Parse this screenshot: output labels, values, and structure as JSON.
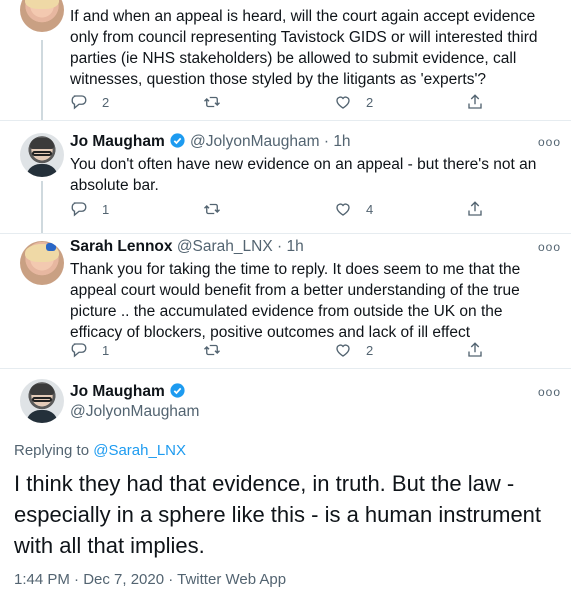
{
  "tweets": [
    {
      "text": "If and when an appeal is heard, will the court again accept evidence only from council representing Tavistock GIDS or will interested third parties (ie NHS stakeholders) be allowed to submit evidence, call witnesses, question those styled by the litigants as 'experts'?",
      "replies": "2",
      "retweets": "",
      "likes": "2"
    },
    {
      "name": "Jo Maugham",
      "handle": "@JolyonMaugham",
      "separator": "·",
      "time": "1h",
      "text": "You don't often have new evidence on an appeal - but there's not an absolute bar.",
      "replies": "1",
      "retweets": "",
      "likes": "4"
    },
    {
      "name": "Sarah Lennox",
      "handle": "@Sarah_LNX",
      "separator": "·",
      "time": "1h",
      "text": "Thank you for taking the time to reply. It does seem to me that the appeal court would benefit from a better understanding of the true picture .. the accumulated evidence from outside the UK on the efficacy of blockers, positive outcomes and lack of ill effect",
      "replies": "1",
      "retweets": "",
      "likes": "2"
    }
  ],
  "main_tweet": {
    "name": "Jo Maugham",
    "handle": "@JolyonMaugham",
    "replying_prefix": "Replying to ",
    "replying_to": "@Sarah_LNX",
    "text": "I think they had that evidence, in truth. But the law - especially in a sphere like this - is a human instrument with all that implies.",
    "timestamp": "1:44 PM · Dec 7, 2020 · Twitter Web App"
  },
  "ui": {
    "more": "ooo"
  },
  "icons": {
    "reply": "reply-icon",
    "retweet": "retweet-icon",
    "like": "heart-icon",
    "share": "share-icon",
    "verified": "verified-badge-icon"
  },
  "colors": {
    "accent": "#1d9bf0",
    "secondary_text": "#536471",
    "verified": "#1d9bf0"
  }
}
